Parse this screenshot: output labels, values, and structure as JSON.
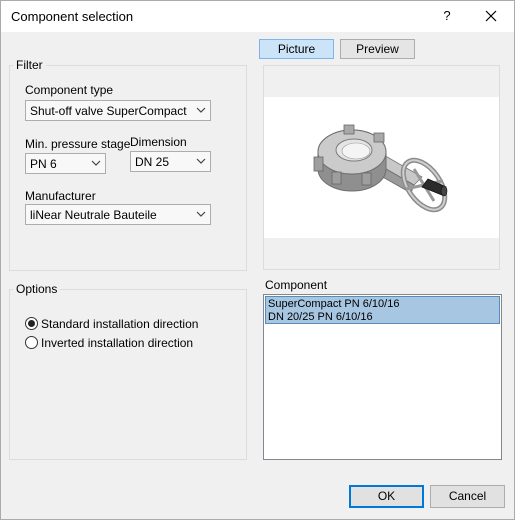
{
  "window": {
    "title": "Component selection",
    "help_label": "?"
  },
  "filter": {
    "group_label": "Filter",
    "component_type": {
      "label": "Component type",
      "value": "Shut-off valve SuperCompact"
    },
    "pressure_stage": {
      "label": "Min. pressure stage",
      "value": "PN 6"
    },
    "dimension": {
      "label": "Dimension",
      "value": "DN 25"
    },
    "manufacturer": {
      "label": "Manufacturer",
      "value": "liNear Neutrale Bauteile"
    }
  },
  "view_tabs": {
    "picture": "Picture",
    "preview": "Preview",
    "active": "picture"
  },
  "options": {
    "group_label": "Options",
    "radios": [
      {
        "label": "Standard installation direction",
        "checked": true
      },
      {
        "label": "Inverted installation direction",
        "checked": false
      }
    ]
  },
  "component": {
    "label": "Component",
    "items": [
      {
        "line1": "SuperCompact PN  6/10/16",
        "line2": "DN  20/25 PN 6/10/16",
        "selected": true
      }
    ]
  },
  "footer": {
    "ok_label": "OK",
    "cancel_label": "Cancel"
  },
  "colors": {
    "selection_bg": "#a6c6e2",
    "active_tab_bg": "#cce4f7",
    "default_button_border": "#0078d7"
  },
  "icons": {
    "close": "close-icon",
    "combo_arrow": "chevron-down-icon",
    "preview": "valve-3d-picture"
  }
}
